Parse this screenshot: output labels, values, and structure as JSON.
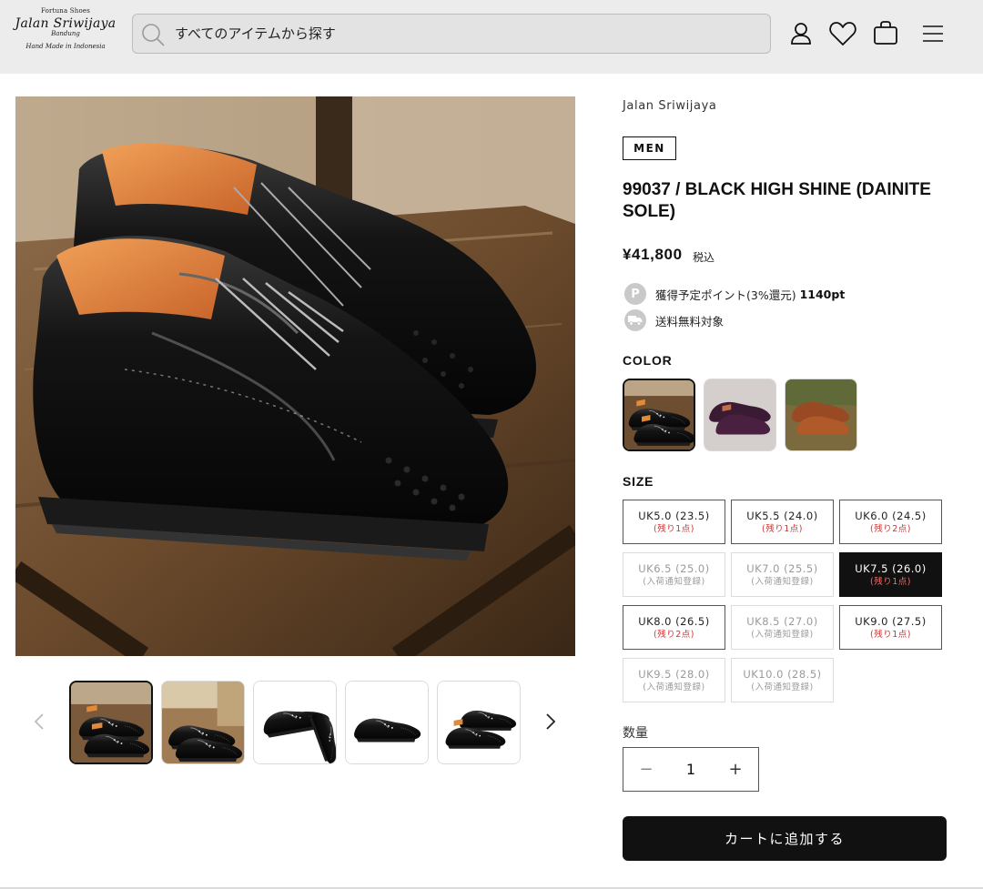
{
  "header": {
    "logo": {
      "top": "Fortuna Shoes",
      "main": "Jalan Sriwijaya",
      "sub": "Bandung",
      "bottom": "Hand Made in Indonesia"
    },
    "search": {
      "placeholder": "すべてのアイテムから探す",
      "icon": "search-icon"
    },
    "icons": [
      "account-icon",
      "heart-icon",
      "bag-icon",
      "menu-icon"
    ]
  },
  "product": {
    "brand": "Jalan Sriwijaya",
    "category_badge": "MEN",
    "title": "99037 / BLACK HIGH SHINE (DAINITE SOLE)",
    "price": "¥41,800",
    "tax_label": "税込",
    "points_icon": "P",
    "points_text": "獲得予定ポイント(3%還元)",
    "points_value": "1140pt",
    "shipping_text": "送料無料対象"
  },
  "color": {
    "label": "COLOR",
    "swatches": [
      {
        "name": "black",
        "selected": true
      },
      {
        "name": "burgundy",
        "selected": false
      },
      {
        "name": "brown",
        "selected": false
      }
    ]
  },
  "size": {
    "label": "SIZE",
    "options": [
      {
        "main": "UK5.0 (23.5)",
        "sub": "(残り1点)",
        "state": "available"
      },
      {
        "main": "UK5.5 (24.0)",
        "sub": "(残り1点)",
        "state": "available"
      },
      {
        "main": "UK6.0 (24.5)",
        "sub": "(残り2点)",
        "state": "available"
      },
      {
        "main": "UK6.5 (25.0)",
        "sub": "(入荷通知登録)",
        "state": "soldout"
      },
      {
        "main": "UK7.0 (25.5)",
        "sub": "(入荷通知登録)",
        "state": "soldout"
      },
      {
        "main": "UK7.5 (26.0)",
        "sub": "(残り1点)",
        "state": "selected"
      },
      {
        "main": "UK8.0 (26.5)",
        "sub": "(残り2点)",
        "state": "available"
      },
      {
        "main": "UK8.5 (27.0)",
        "sub": "(入荷通知登録)",
        "state": "soldout"
      },
      {
        "main": "UK9.0 (27.5)",
        "sub": "(残り1点)",
        "state": "available"
      },
      {
        "main": "UK9.5 (28.0)",
        "sub": "(入荷通知登録)",
        "state": "soldout"
      },
      {
        "main": "UK10.0 (28.5)",
        "sub": "(入荷通知登録)",
        "state": "soldout"
      }
    ]
  },
  "quantity": {
    "label": "数量",
    "value": "1",
    "minus": "−",
    "plus": "+"
  },
  "cart_button": "カートに追加する",
  "gallery": {
    "thumbnails": 5,
    "active_index": 0,
    "prev_icon": "chevron-left-icon",
    "next_icon": "chevron-right-icon"
  },
  "colors": {
    "header_bg": "#ececec",
    "accent": "#111111",
    "stock_red": "#d0312d",
    "leather_black": "#141414",
    "lining_orange": "#e07a2e"
  }
}
